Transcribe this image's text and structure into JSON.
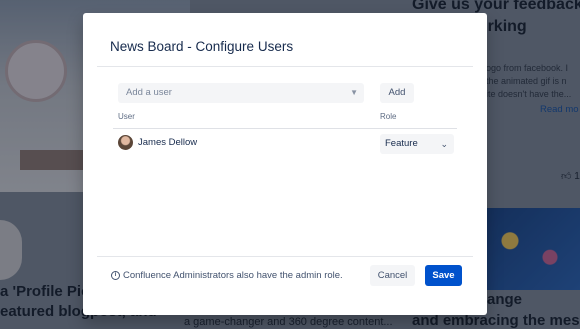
{
  "background": {
    "left_card_title": "a 'Profile Pic\neatured blogpost, and",
    "mid_card_snippet": "a game-changer and 360 degree content...",
    "right_top_title": "Give us your feedback\n    new working\n    ents",
    "right_top_snippet": "ogo from facebook. I\nthe animated gif is n\nite doesn't have the...",
    "read_more": "Read mo",
    "like_count": "1",
    "right_bottom_title": "    ough change\nand embracing the mess."
  },
  "modal": {
    "title": "News Board - Configure Users",
    "add_user_placeholder": "Add a user",
    "add_button": "Add",
    "columns": {
      "user": "User",
      "role": "Role"
    },
    "users": [
      {
        "name": "James Dellow",
        "role": "Feature"
      }
    ],
    "footer_info": "Confluence Administrators also have the admin role.",
    "cancel_button": "Cancel",
    "save_button": "Save"
  },
  "colors": {
    "primary": "#0052cc",
    "overlay": "rgba(9,30,66,0.40)"
  },
  "icons": {
    "dropdown": "chevron-down-icon",
    "info": "info-icon",
    "like": "thumbs-up-icon"
  }
}
